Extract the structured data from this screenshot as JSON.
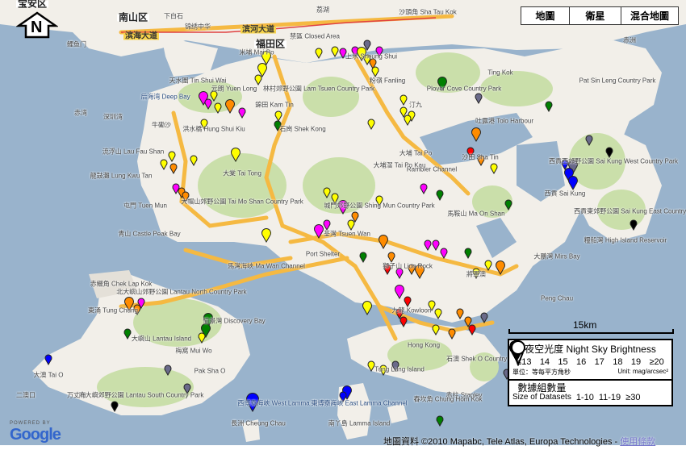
{
  "map_type_buttons": [
    "地圖",
    "衛星",
    "混合地圖"
  ],
  "north_label": "N",
  "scale": "15km",
  "legend": {
    "brightness_title": "夜空光度 Night Sky Brightness",
    "levels": [
      {
        "label": "≤13",
        "color": "#ff0000"
      },
      {
        "label": "14",
        "color": "#ff00ff"
      },
      {
        "label": "15",
        "color": "#ff8c00"
      },
      {
        "label": "16",
        "color": "#ffff00"
      },
      {
        "label": "17",
        "color": "#008000"
      },
      {
        "label": "18",
        "color": "#0000ff"
      },
      {
        "label": "19",
        "color": "#6a6a8a"
      },
      {
        "label": "≥20",
        "color": "#000000"
      }
    ],
    "unit_zh": "單位：等每平方角秒",
    "unit_en": "Unit: mag/arcsec²",
    "size_title_zh": "數據組數量",
    "size_title_en": "Size of Datasets",
    "sizes": [
      "1-10",
      "11-19",
      "≥30"
    ]
  },
  "google": {
    "powered_by": "POWERED BY",
    "logo": "Google"
  },
  "attribution": "地圖資料 ©2010 Mapabc, Tele Atlas, Europa Technologies - ",
  "terms_link": "使用條款",
  "places": [
    "宝安区",
    "南山区",
    "下白石",
    "锦绣中华",
    "滨海大道",
    "滨河大道",
    "福田区",
    "禁區 Closed Area",
    "荔湖",
    "鲤鱼门",
    "赤湾",
    "深圳湾",
    "后海湾 Deep Bay",
    "牛磡沙",
    "流浮山 Lau Fau Shan",
    "龍鼓灘 Lung Kwu Tan",
    "屯門 Tuen Mun",
    "米埔 Mai Po",
    "天水圍 Tin Shui Wai",
    "洪水橋 Hung Shui Kiu",
    "錦田 Kam Tin",
    "元朗 Yuen Long",
    "石崗 Shek Kong",
    "大棠 Tai Tong",
    "林村郊野公園 Lam Tsuen Country Park",
    "上水 Sheung Shui",
    "粉嶺 Fanling",
    "沙頭角 Sha Tau Kok",
    "大埔 Tai Po",
    "大埔滘 Tai Po Kau",
    "大帽山郊野公園 Tai Mo Shan Country Park",
    "城門郊野公園 Shing Mun Country Park",
    "荃灣 Tsuen Wan",
    "沙田 Sha Tin",
    "馬鞍山 Ma On Shan",
    "西貢 Sai Kung",
    "西貢西郊野公園 Sai Kung West Country Park",
    "西貢東郊野公園 Sai Kung East Country Park",
    "糧船灣 High Island Reservoir",
    "九龍 Kowloon",
    "獅子山 Lion Rock",
    "將軍澳",
    "馬灣海峽 Ma Wan Channel",
    "青山 Castle Peak Bay",
    "赤鱲角 Chek Lap Kok",
    "北大嶼山郊野公園 Lantau North Country Park",
    "東涌 Tung Chung",
    "愉景灣 Discovery Bay",
    "梅窩 Mui Wo",
    "大嶼山 Lantau Island",
    "南大嶼郊野公園 Lantau South Country Park",
    "大澳 Tai O",
    "二澳口",
    "万丈布",
    "長洲 Cheung Chau",
    "西博寮海峽 West Lamma Channel",
    "東博寮海峽 East Lamma Channel",
    "南丫島 Lamma Island",
    "赤柱 Stanley",
    "舂坎角 Chung Hom Kok",
    "石澳 Shek O Country Park",
    "吐露港 Tolo Harbour",
    "赤洲",
    "大鵬灣 Mirs Bay",
    "Port Shelter",
    "Rambler Channel",
    "汀九",
    "Ting Kok",
    "Plover Cove Country Park",
    "Pat Sin Leng Country Park",
    "Pak Sha O",
    "Peng Chau",
    "Tung Lung Island",
    "Hong Kong"
  ]
}
